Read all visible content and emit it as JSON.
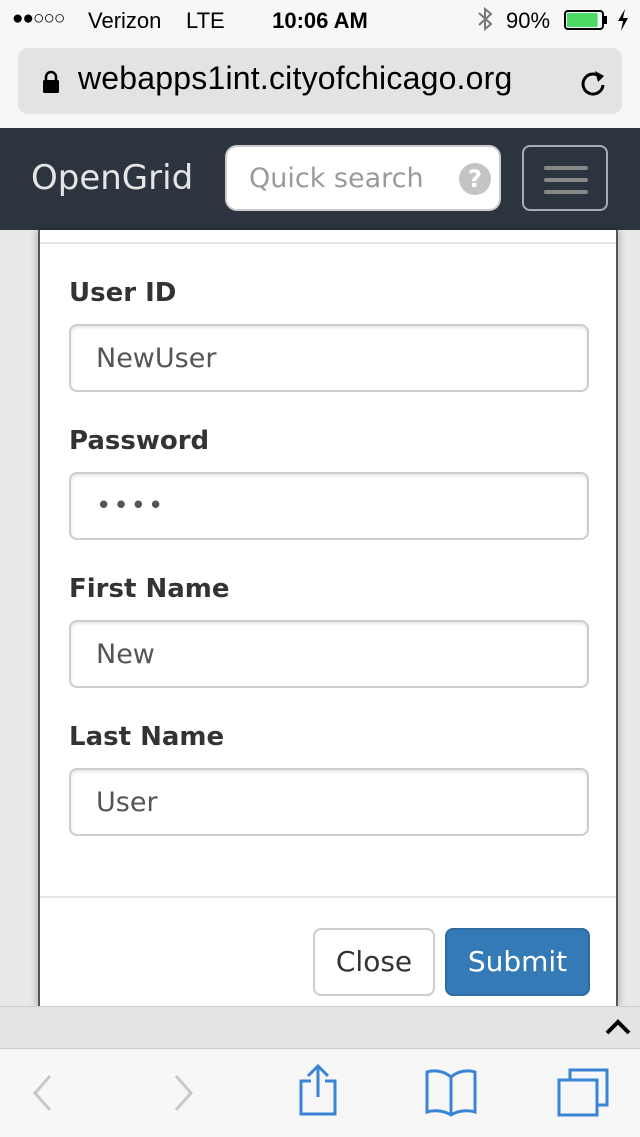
{
  "status_bar": {
    "signal": "●●○○○",
    "carrier": "Verizon",
    "network": "LTE",
    "time": "10:06 AM",
    "battery_percent": "90%",
    "battery_level": 0.9
  },
  "url_bar": {
    "url": "webapps1int.cityofchicago.org"
  },
  "navbar": {
    "brand": "OpenGrid",
    "search_placeholder": "Quick search",
    "help_symbol": "?"
  },
  "form": {
    "fields": [
      {
        "label": "User ID",
        "value": "NewUser"
      },
      {
        "label": "Password",
        "value": "••••"
      },
      {
        "label": "First Name",
        "value": "New"
      },
      {
        "label": "Last Name",
        "value": "User"
      }
    ],
    "close_label": "Close",
    "submit_label": "Submit"
  },
  "colors": {
    "navbar_bg": "#2c3440",
    "primary": "#337ab7",
    "ios_blue": "#3a84d8",
    "battery_green": "#4cd964"
  },
  "icons": {
    "lock": "lock-icon",
    "reload": "reload-icon",
    "bluetooth": "bluetooth-icon",
    "battery": "battery-icon",
    "help": "help-icon",
    "menu": "hamburger-icon",
    "collapse": "chevron-up-icon",
    "back": "back-arrow-icon",
    "forward": "forward-arrow-icon",
    "share": "share-icon",
    "bookmarks": "bookmarks-icon",
    "tabs": "tabs-icon"
  }
}
